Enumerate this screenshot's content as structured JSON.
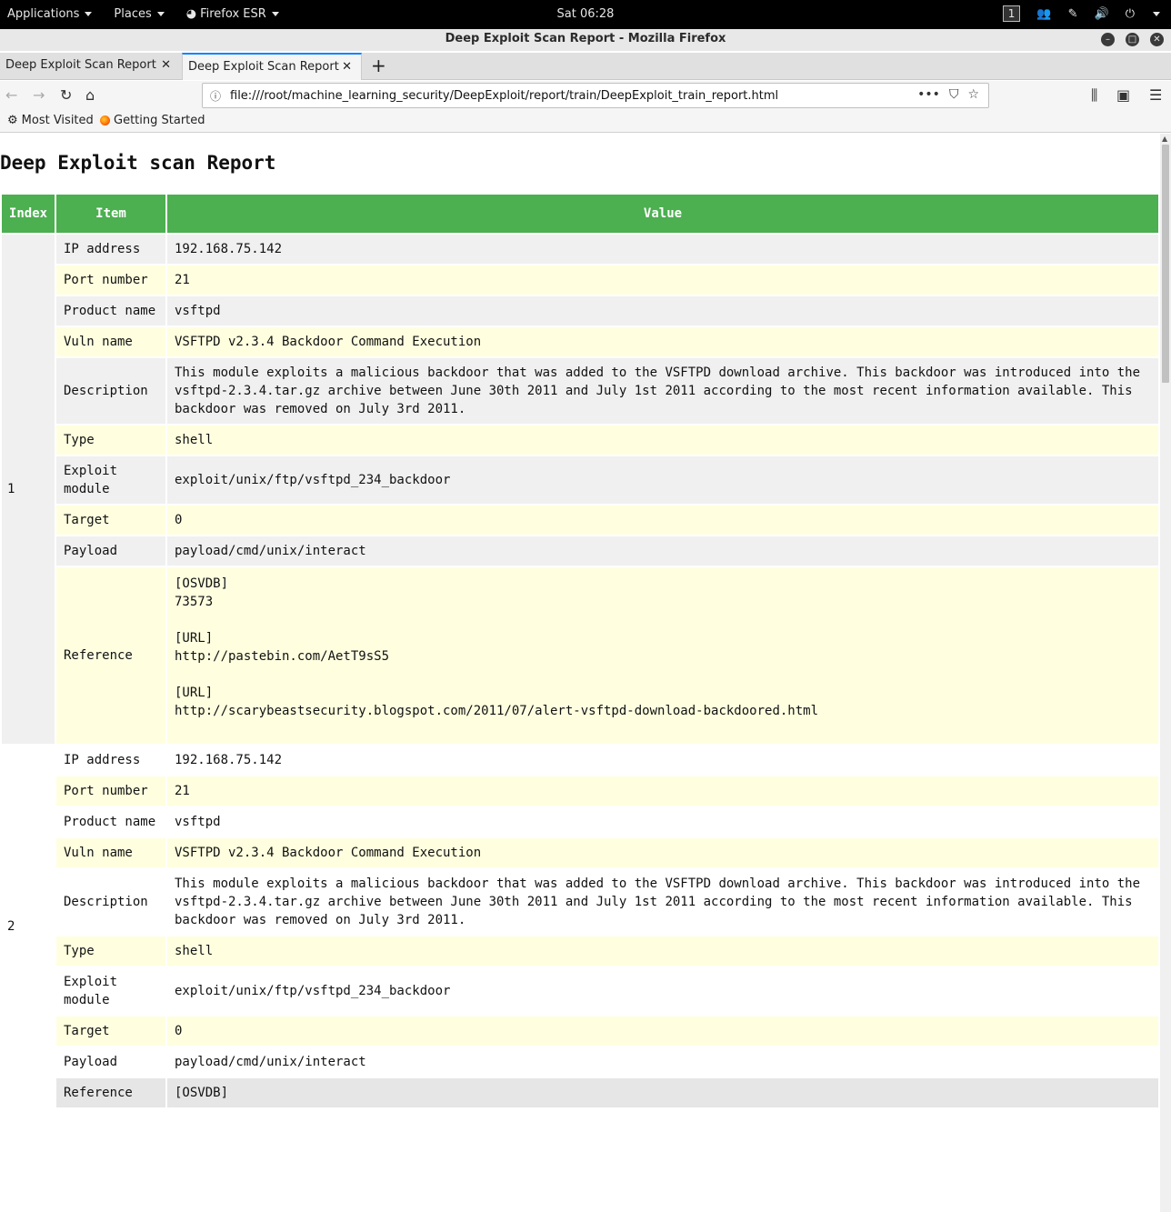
{
  "system": {
    "applications_label": "Applications",
    "places_label": "Places",
    "firefox_label": "Firefox ESR",
    "clock": "Sat 06:28",
    "workspace": "1"
  },
  "window": {
    "title": "Deep Exploit Scan Report - Mozilla Firefox"
  },
  "tabs": [
    {
      "label": "Deep Exploit Scan Report"
    },
    {
      "label": "Deep Exploit Scan Report"
    }
  ],
  "navbar": {
    "url": "file:///root/machine_learning_security/DeepExploit/report/train/DeepExploit_train_report.html"
  },
  "bookmarks": [
    {
      "label": "Most Visited"
    },
    {
      "label": "Getting Started"
    }
  ],
  "report": {
    "title": "Deep Exploit scan Report",
    "headers": {
      "index": "Index",
      "item": "Item",
      "value": "Value"
    },
    "entries": [
      {
        "index": "1",
        "ip_label": "IP address",
        "ip": "192.168.75.142",
        "port_label": "Port number",
        "port": "21",
        "product_label": "Product name",
        "product": "vsftpd",
        "vuln_label": "Vuln name",
        "vuln": "VSFTPD v2.3.4 Backdoor Command Execution",
        "desc_label": "Description",
        "desc": "This module exploits a malicious backdoor that was added to the VSFTPD download archive. This backdoor was introduced into the vsftpd-2.3.4.tar.gz archive between June 30th 2011 and July 1st 2011 according to the most recent information available. This backdoor was removed on July 3rd 2011.",
        "type_label": "Type",
        "type": "shell",
        "module_label": "Exploit module",
        "module": "exploit/unix/ftp/vsftpd_234_backdoor",
        "target_label": "Target",
        "target": "0",
        "payload_label": "Payload",
        "payload": "payload/cmd/unix/interact",
        "ref_label": "Reference",
        "ref": {
          "osvdb_tag": "[OSVDB]",
          "osvdb": "73573",
          "url1_tag": "[URL]",
          "url1": "http://pastebin.com/AetT9sS5",
          "url2_tag": "[URL]",
          "url2": "http://scarybeastsecurity.blogspot.com/2011/07/alert-vsftpd-download-backdoored.html"
        }
      },
      {
        "index": "2",
        "ip_label": "IP address",
        "ip": "192.168.75.142",
        "port_label": "Port number",
        "port": "21",
        "product_label": "Product name",
        "product": "vsftpd",
        "vuln_label": "Vuln name",
        "vuln": "VSFTPD v2.3.4 Backdoor Command Execution",
        "desc_label": "Description",
        "desc": "This module exploits a malicious backdoor that was added to the VSFTPD download archive. This backdoor was introduced into the vsftpd-2.3.4.tar.gz archive between June 30th 2011 and July 1st 2011 according to the most recent information available. This backdoor was removed on July 3rd 2011.",
        "type_label": "Type",
        "type": "shell",
        "module_label": "Exploit module",
        "module": "exploit/unix/ftp/vsftpd_234_backdoor",
        "target_label": "Target",
        "target": "0",
        "payload_label": "Payload",
        "payload": "payload/cmd/unix/interact",
        "ref_label": "Reference",
        "ref": {
          "osvdb_tag": "[OSVDB]"
        }
      }
    ]
  }
}
